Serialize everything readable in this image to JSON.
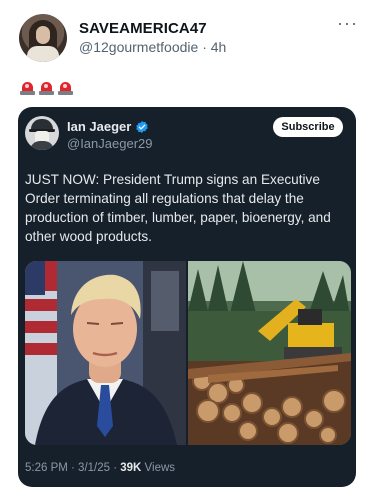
{
  "post": {
    "author_name": "SAVEAMERICA47",
    "handle": "@12gourmetfoodie",
    "separator": "·",
    "time_ago": "4h",
    "more_label": "···",
    "emoji_names": [
      "police-light-icon",
      "police-light-icon",
      "police-light-icon"
    ]
  },
  "quote": {
    "author_name": "Ian Jaeger",
    "handle": "@IanJaeger29",
    "subscribe_label": "Subscribe",
    "text": "JUST NOW: President Trump signs an Executive Order terminating all regulations that delay the production of timber, lumber, paper, bioenergy, and other wood products.",
    "media": [
      {
        "name": "portrait-photo"
      },
      {
        "name": "timber-logging-photo"
      }
    ],
    "timestamp": "5:26 PM · 3/1/25 · ",
    "views_count": "39K",
    "views_label": " Views",
    "verified_color": "#1d9bf0"
  },
  "colors": {
    "card_bg": "#15202b",
    "siren": "#e0262c"
  }
}
